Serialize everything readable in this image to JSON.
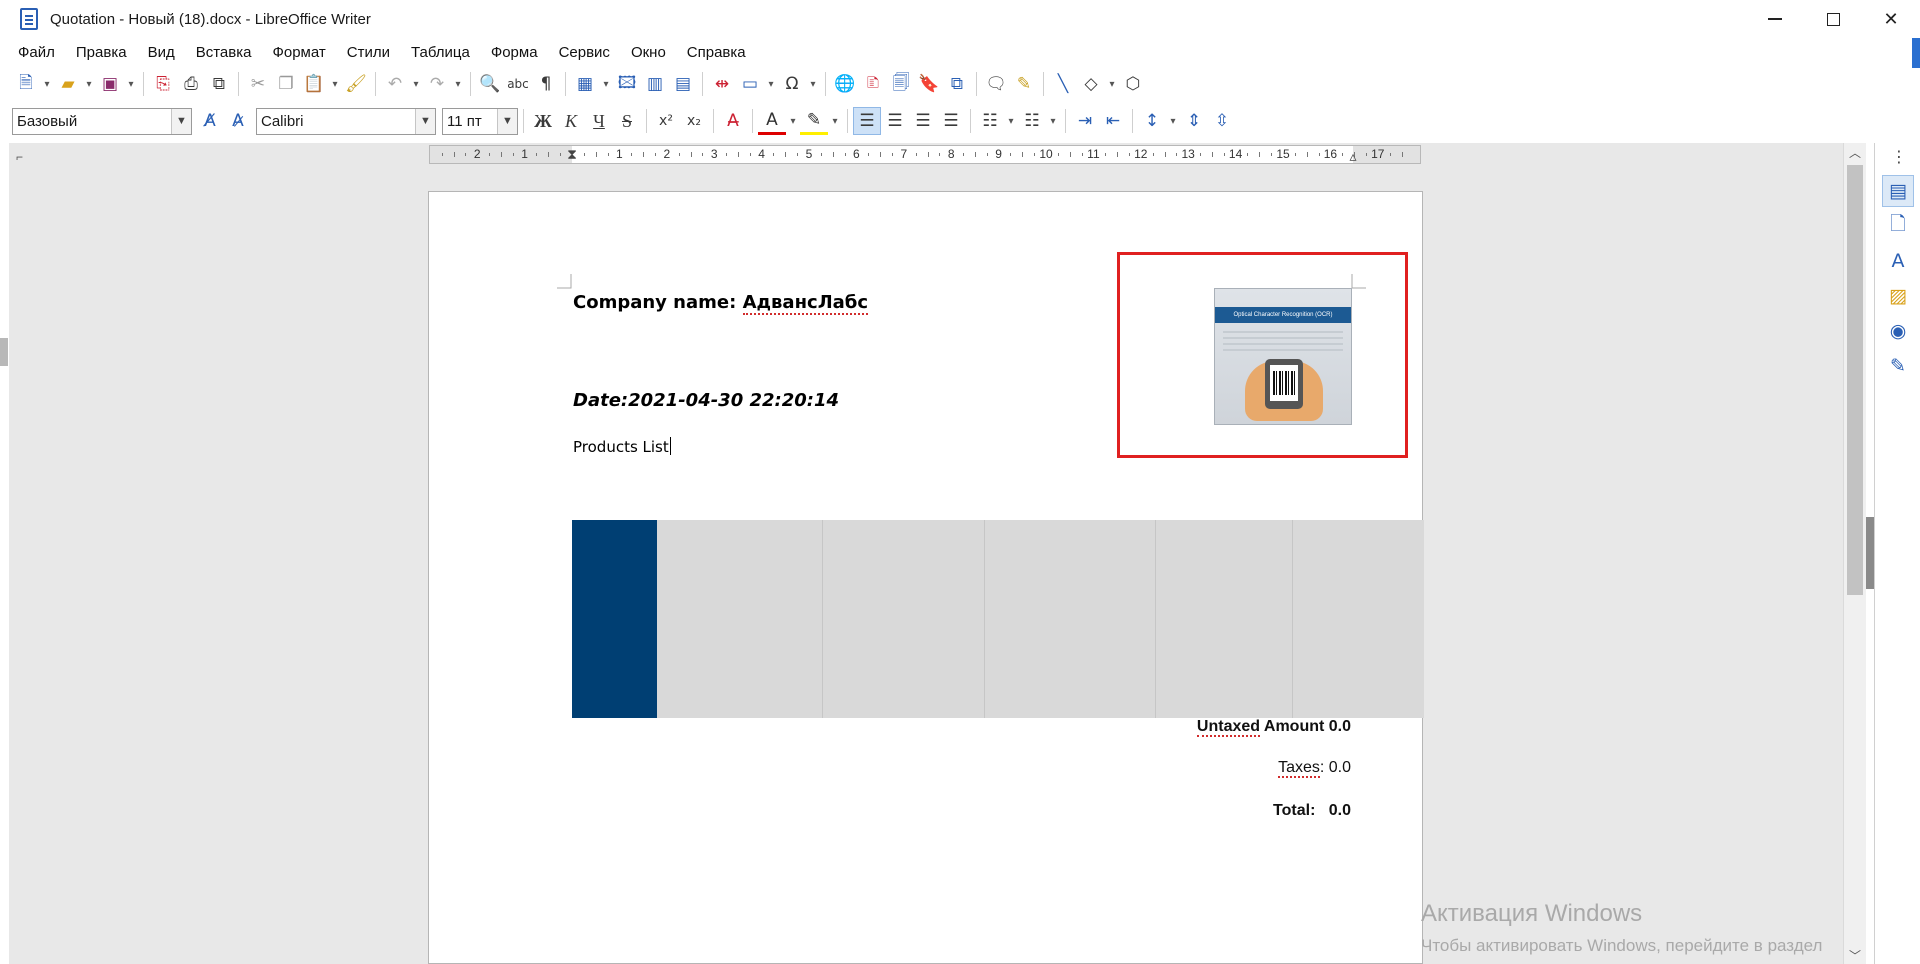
{
  "window": {
    "title": "Quotation - Новый (18).docx - LibreOffice Writer",
    "minimize": "–",
    "maximize": "□",
    "close": "✕"
  },
  "menu": [
    "Файл",
    "Правка",
    "Вид",
    "Вставка",
    "Формат",
    "Стили",
    "Таблица",
    "Форма",
    "Сервис",
    "Окно",
    "Справка"
  ],
  "formatting": {
    "paragraph_style": "Базовый",
    "font_name": "Calibri",
    "font_size": "11 пт",
    "bold": "Ж",
    "italic": "К",
    "underline": "Ч",
    "strike": "S",
    "superscript": "x²",
    "subscript": "x₂"
  },
  "ruler": {
    "labels": [
      "2",
      "1",
      "1",
      "2",
      "3",
      "4",
      "5",
      "6",
      "7",
      "8",
      "9",
      "10",
      "11",
      "12",
      "13",
      "14",
      "15",
      "16",
      "17"
    ]
  },
  "document": {
    "company_label": "Company name: ",
    "company_name": "АдвансЛабс",
    "date": "Date:2021-04-30 22:20:14",
    "products_heading": "Products List",
    "image_caption": "Optical Character Recognition (OCR)",
    "totals": {
      "untaxed_label": "Untaxed",
      "untaxed_rest": " Amount 0.0",
      "taxes_label": "Taxes",
      "taxes_rest": ": 0.0",
      "total_label": "Total:",
      "total_value": "0.0"
    }
  },
  "watermark": {
    "line1": "Активация Windows",
    "line2": "Чтобы активировать Windows, перейдите в раздел"
  },
  "colors": {
    "table_header_accent": "#003f73",
    "selection_frame": "#e02020",
    "table_fill": "#d9d9d9"
  },
  "icons": {
    "toolbar_standard": [
      "new-document-icon",
      "open-folder-icon",
      "save-icon",
      "export-pdf-icon",
      "print-icon",
      "print-preview-icon",
      "cut-icon",
      "copy-icon",
      "paste-icon",
      "clone-formatting-icon",
      "undo-icon",
      "redo-icon",
      "find-replace-icon",
      "spellcheck-icon",
      "formatting-marks-icon",
      "insert-table-icon",
      "insert-image-icon",
      "insert-chart-icon",
      "insert-textbox-icon",
      "page-break-icon",
      "insert-field-icon",
      "special-character-icon",
      "hyperlink-icon",
      "footnote-icon",
      "endnote-icon",
      "bookmark-icon",
      "cross-reference-icon",
      "comment-icon",
      "track-changes-icon",
      "line-icon",
      "shapes-icon",
      "draw-functions-icon"
    ],
    "sidebar": [
      "properties-icon",
      "page-icon",
      "styles-icon",
      "gallery-icon",
      "navigator-icon",
      "manage-changes-icon"
    ]
  }
}
